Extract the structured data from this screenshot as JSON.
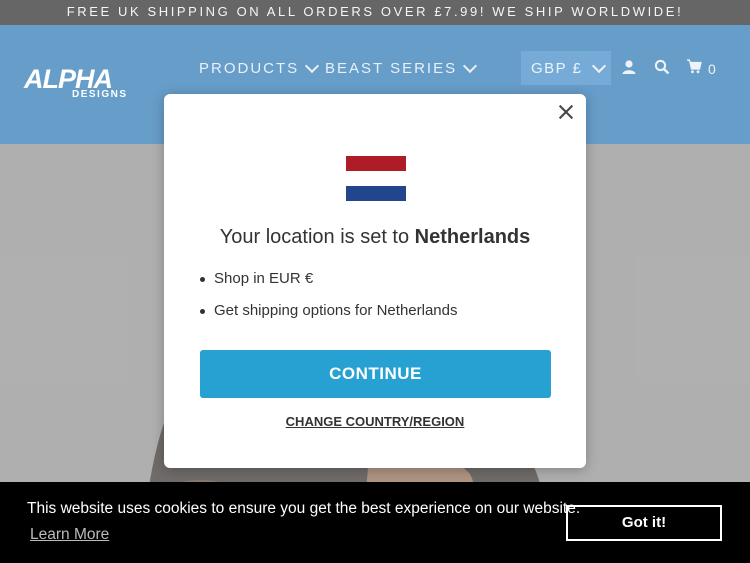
{
  "announcement": "FREE UK SHIPPING ON ALL ORDERS OVER £7.99! WE SHIP WORLDWIDE!",
  "logo": {
    "main": "ALPHA",
    "sub": "DESIGNS"
  },
  "nav": {
    "products": "PRODUCTS",
    "beast_series": "BEAST SERIES"
  },
  "currency": "GBP £",
  "cart_count": "0",
  "modal": {
    "title_prefix": "Your location is set to",
    "country": "Netherlands",
    "bullets": [
      "Shop in EUR €",
      "Get shipping options for Netherlands"
    ],
    "continue_label": "CONTINUE",
    "change_label": "CHANGE COUNTRY/REGION",
    "flag_colors": [
      "#ae1c28",
      "#ffffff",
      "#21468b"
    ]
  },
  "cookie": {
    "message": "This website uses cookies to ensure you get the best experience on our website.",
    "learn_more": "Learn More",
    "got_it": "Got it!"
  },
  "icons": [
    "user-icon",
    "search-icon",
    "cart-icon",
    "close-icon",
    "chevron-down-icon"
  ]
}
